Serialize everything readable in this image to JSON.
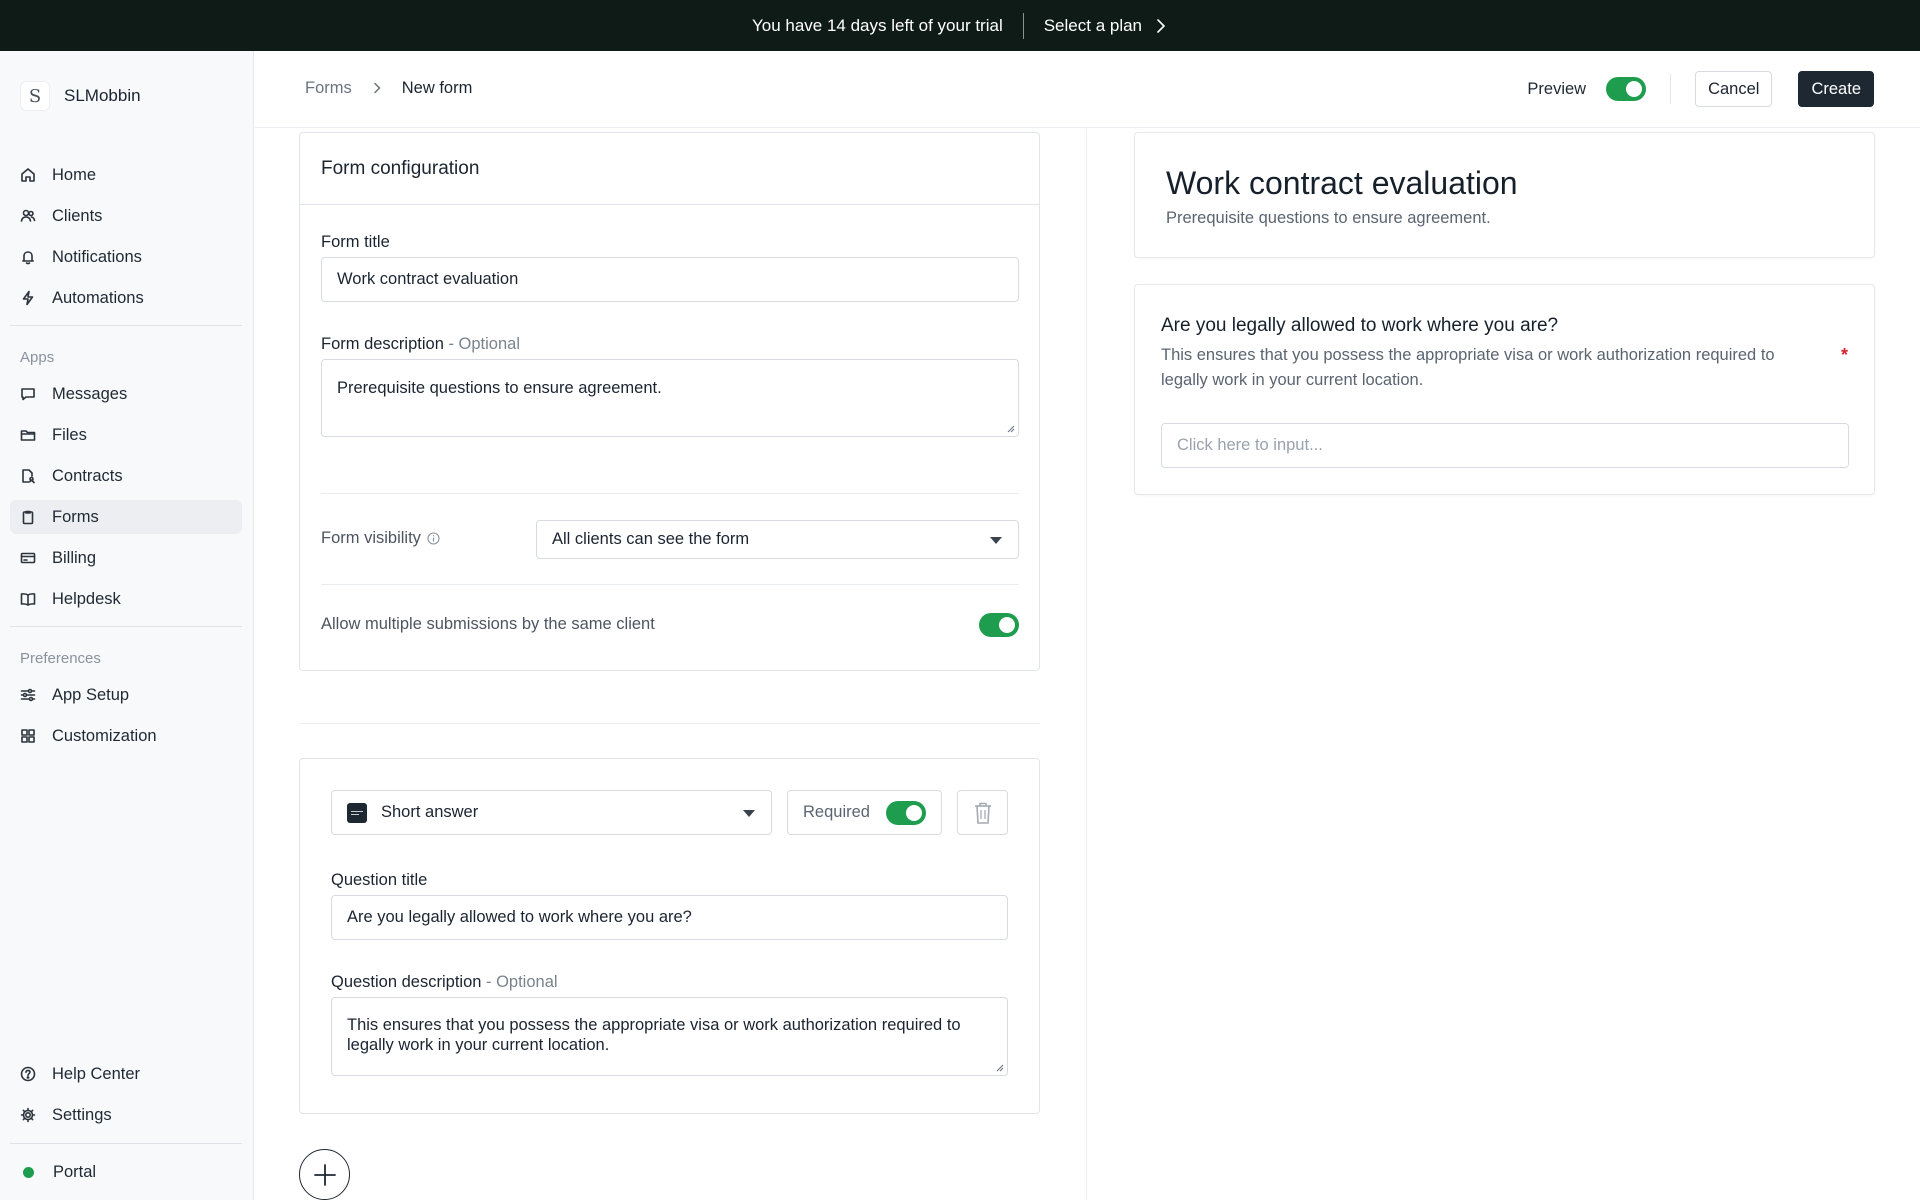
{
  "banner": {
    "trial_text": "You have 14 days left of your trial",
    "plan_link": "Select a plan"
  },
  "sidebar": {
    "brand": {
      "logo_letter": "S",
      "name": "SLMobbin"
    },
    "main_items": [
      {
        "label": "Home",
        "icon": "home-icon"
      },
      {
        "label": "Clients",
        "icon": "users-icon"
      },
      {
        "label": "Notifications",
        "icon": "bell-icon"
      },
      {
        "label": "Automations",
        "icon": "bolt-icon"
      }
    ],
    "apps_heading": "Apps",
    "app_items": [
      {
        "label": "Messages",
        "icon": "message-icon"
      },
      {
        "label": "Files",
        "icon": "folder-icon"
      },
      {
        "label": "Contracts",
        "icon": "contract-icon"
      },
      {
        "label": "Forms",
        "icon": "clipboard-icon",
        "active": true
      },
      {
        "label": "Billing",
        "icon": "credit-card-icon"
      },
      {
        "label": "Helpdesk",
        "icon": "book-icon"
      }
    ],
    "preferences_heading": "Preferences",
    "pref_items": [
      {
        "label": "App Setup",
        "icon": "sliders-icon"
      },
      {
        "label": "Customization",
        "icon": "grid-icon"
      }
    ],
    "bottom_items": [
      {
        "label": "Help Center",
        "icon": "help-circle-icon"
      },
      {
        "label": "Settings",
        "icon": "gear-icon"
      }
    ],
    "portal": {
      "label": "Portal",
      "status_color": "#1f9d4f"
    }
  },
  "header": {
    "breadcrumb": [
      "Forms",
      "New form"
    ],
    "preview_label": "Preview",
    "preview_on": true,
    "cancel_label": "Cancel",
    "create_label": "Create"
  },
  "config": {
    "heading": "Form configuration",
    "title_label": "Form title",
    "title_value": "Work contract evaluation",
    "desc_label": "Form description",
    "optional_suffix": " - Optional",
    "desc_value": "Prerequisite questions to ensure agreement.",
    "visibility_label": "Form visibility",
    "visibility_value": "All clients can see the form",
    "multiple_label": "Allow multiple submissions by the same client",
    "multiple_on": true
  },
  "question": {
    "type_value": "Short answer",
    "required_label": "Required",
    "required_on": true,
    "title_label": "Question title",
    "title_value": "Are you legally allowed to work where you are?",
    "desc_label": "Question description",
    "optional_suffix": " - Optional",
    "desc_value": "This ensures that you possess the appropriate visa or work authorization required to legally work in your current location."
  },
  "preview": {
    "form_title": "Work contract evaluation",
    "form_desc": "Prerequisite questions to ensure agreement.",
    "q_title": "Are you legally allowed to work where you are?",
    "q_desc": "This ensures that you possess the appropriate visa or work authorization required to legally work in your current location.",
    "required_marker": "*",
    "input_placeholder": "Click here to input..."
  },
  "colors": {
    "accent_green": "#1f9d4f",
    "banner_bg": "#0f1b17",
    "primary_button": "#1e2833",
    "required_red": "#d1242f"
  }
}
